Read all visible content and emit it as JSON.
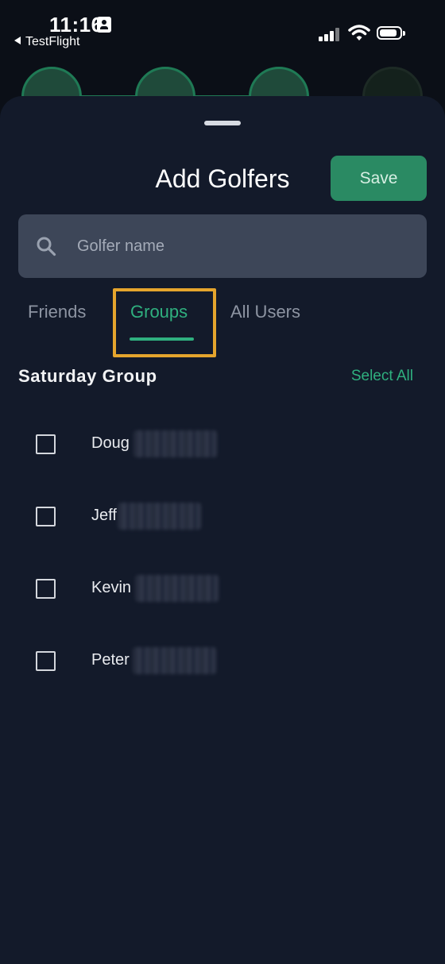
{
  "status_bar": {
    "time": "11:16",
    "back_app": "TestFlight",
    "icons": [
      "id-card-icon",
      "cellular-signal-icon",
      "wifi-icon",
      "battery-icon"
    ]
  },
  "sheet": {
    "title": "Add Golfers",
    "save_label": "Save",
    "search": {
      "placeholder": "Golfer name",
      "value": ""
    },
    "tabs": [
      {
        "label": "Friends",
        "active": false
      },
      {
        "label": "Groups",
        "active": true
      },
      {
        "label": "All Users",
        "active": false
      }
    ],
    "group": {
      "title": "Saturday Group",
      "select_all_label": "Select All",
      "members": [
        {
          "first_name": "Doug",
          "checked": false
        },
        {
          "first_name": "Jeff",
          "checked": false
        },
        {
          "first_name": "Kevin",
          "checked": false
        },
        {
          "first_name": "Peter",
          "checked": false
        }
      ]
    }
  },
  "colors": {
    "background": "#131a2a",
    "accent": "#2fb07f",
    "save_button": "#2a8a63",
    "highlight": "#e5a52d",
    "search_bg": "#3d4658"
  }
}
